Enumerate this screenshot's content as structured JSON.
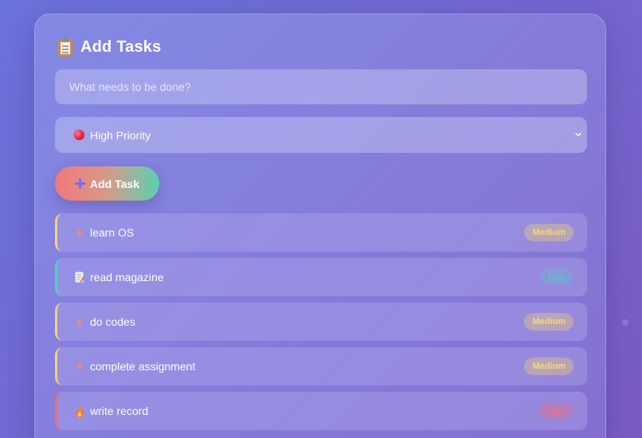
{
  "header": {
    "title": "Add Tasks",
    "icon": "clipboard-icon"
  },
  "form": {
    "input_placeholder": "What needs to be done?",
    "input_value": "",
    "priority_selected": "High Priority",
    "priority_icon": "red-circle-icon",
    "add_button_label": "Add Task",
    "add_button_icon": "plus-icon"
  },
  "tasks": [
    {
      "text": "learn OS",
      "priority": "Medium",
      "icon": "lightning-icon",
      "accent": "#f3d27a"
    },
    {
      "text": "read magazine",
      "priority": "Low",
      "icon": "memo-icon",
      "accent": "#4fd1c5"
    },
    {
      "text": "do codes",
      "priority": "Medium",
      "icon": "lightning-icon",
      "accent": "#f3d27a"
    },
    {
      "text": "complete assignment",
      "priority": "Medium",
      "icon": "lightning-icon",
      "accent": "#f3d27a"
    },
    {
      "text": "write record",
      "priority": "High",
      "icon": "fire-icon",
      "accent": "#f06c7a"
    }
  ],
  "colors": {
    "medium": "#f3d27a",
    "low": "#4fd1c5",
    "high": "#f06c7a"
  }
}
